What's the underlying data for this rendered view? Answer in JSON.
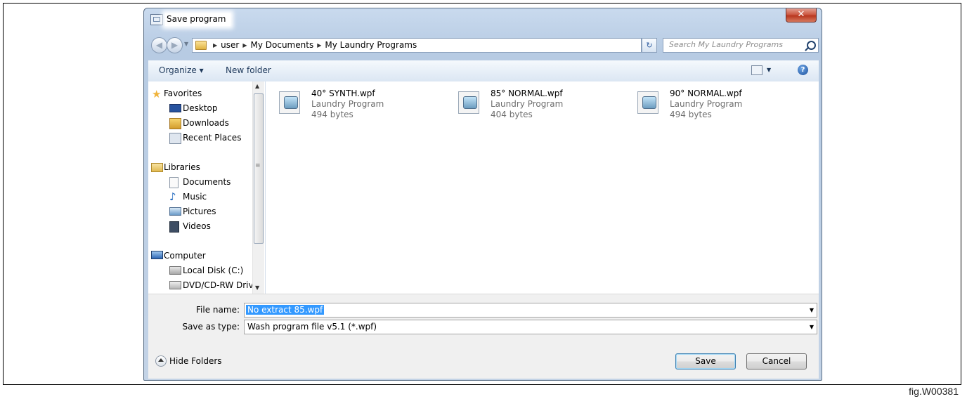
{
  "window": {
    "title": "Save program",
    "close_glyph": "✕"
  },
  "navigation": {
    "back_glyph": "◀",
    "forward_glyph": "▶",
    "breadcrumbs": [
      "user",
      "My Documents",
      "My Laundry Programs"
    ],
    "search_placeholder": "Search My Laundry Programs"
  },
  "toolbar": {
    "organize_label": "Organize ▾",
    "new_folder_label": "New folder",
    "help_glyph": "?"
  },
  "sidebar": {
    "items": [
      {
        "label": "Favorites",
        "icon": "star-icon"
      },
      {
        "label": "Desktop",
        "icon": "desktop-icon"
      },
      {
        "label": "Downloads",
        "icon": "downloads-icon"
      },
      {
        "label": "Recent Places",
        "icon": "recent-places-icon"
      },
      {
        "label": "Libraries",
        "icon": "libraries-icon"
      },
      {
        "label": "Documents",
        "icon": "documents-icon"
      },
      {
        "label": "Music",
        "icon": "music-icon"
      },
      {
        "label": "Pictures",
        "icon": "pictures-icon"
      },
      {
        "label": "Videos",
        "icon": "videos-icon"
      },
      {
        "label": "Computer",
        "icon": "computer-icon"
      },
      {
        "label": "Local Disk (C:)",
        "icon": "local-disk-icon"
      },
      {
        "label": "DVD/CD-RW Driv",
        "icon": "dvd-drive-icon"
      }
    ]
  },
  "files": [
    {
      "name": "40° SYNTH.wpf",
      "type": "Laundry Program",
      "size": "494 bytes"
    },
    {
      "name": "85° NORMAL.wpf",
      "type": "Laundry Program",
      "size": "404 bytes"
    },
    {
      "name": "90° NORMAL.wpf",
      "type": "Laundry Program",
      "size": "494 bytes"
    }
  ],
  "form": {
    "file_name_label": "File name:",
    "file_name_value": "No extract 85.wpf",
    "save_type_label": "Save as type:",
    "save_type_value": "Wash program file v5.1 (*.wpf)"
  },
  "footer": {
    "hide_folders_label": "Hide Folders",
    "save_label": "Save",
    "cancel_label": "Cancel"
  },
  "figure_label": "fig.W00381"
}
